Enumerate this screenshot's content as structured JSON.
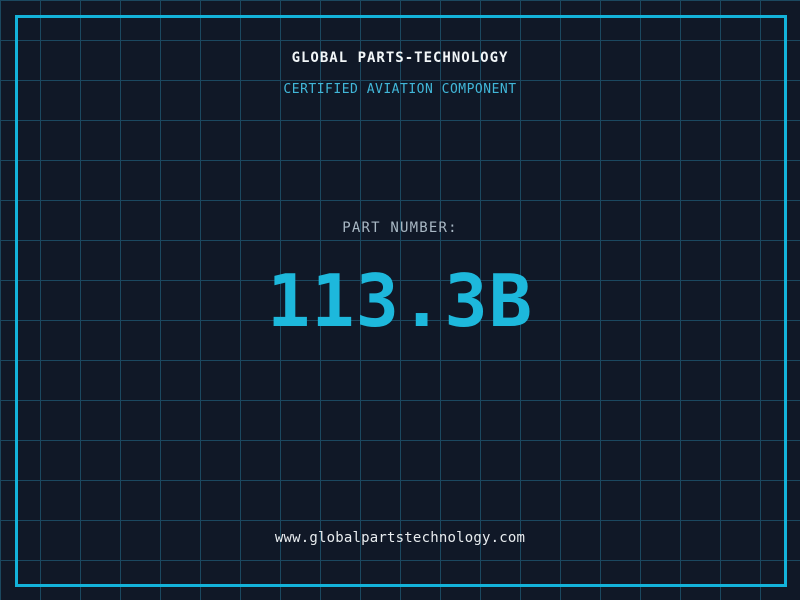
{
  "placard": {
    "title": "GLOBAL PARTS-TECHNOLOGY",
    "subtitle": "CERTIFIED AVIATION COMPONENT",
    "part_number_label": "PART NUMBER:",
    "part_number_value": "113.3B",
    "website": "www.globalpartstechnology.com"
  },
  "colors": {
    "background": "#101827",
    "grid_line": "#1b4860",
    "frame": "#13b2da",
    "accent_cyan": "#1db8dc",
    "subtitle_cyan": "#41b7d9",
    "title_white": "#f2f6f8",
    "label_gray": "#a9b8c4",
    "url_white": "#e9edf0"
  },
  "layout_meta": {
    "grid_cell_px": "40"
  }
}
